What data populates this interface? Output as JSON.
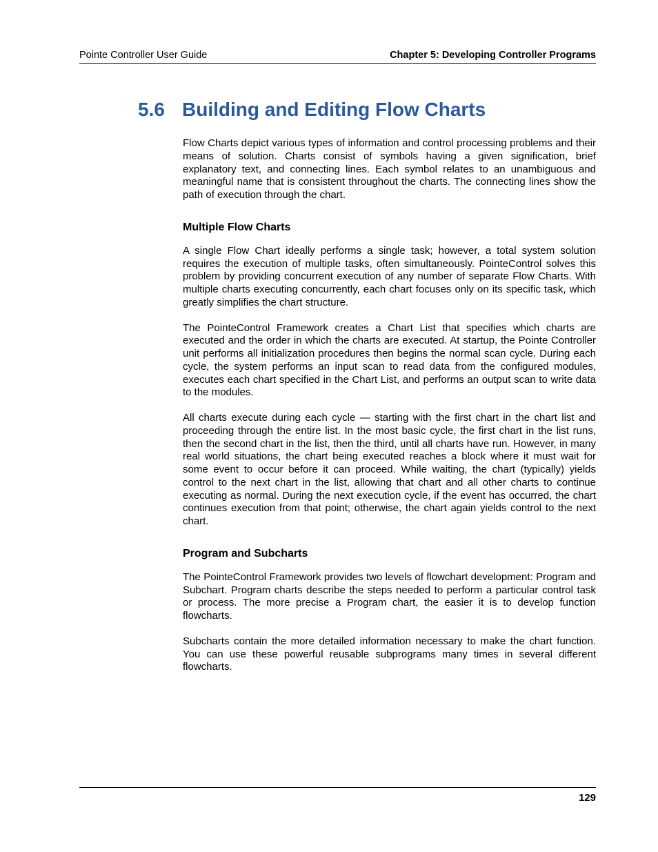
{
  "header": {
    "left": "Pointe Controller User Guide",
    "right": "Chapter 5: Developing Controller Programs"
  },
  "section": {
    "number": "5.6",
    "title": "Building and Editing Flow Charts"
  },
  "intro": "Flow Charts depict various types of information and control processing problems and their means of solution. Charts consist of symbols having a given signification, brief explanatory text, and connecting lines. Each symbol relates to an unambiguous and meaningful name that is consistent throughout the charts. The connecting lines show the path of execution through the chart.",
  "sub1": {
    "heading": "Multiple Flow Charts",
    "p1": "A single Flow Chart ideally performs a single task; however, a total system solution requires the execution of multiple tasks, often simultaneously. PointeControl solves this problem by providing concurrent execution of any number of separate Flow Charts. With multiple charts executing concurrently, each chart focuses only on its specific task, which greatly simplifies the chart structure.",
    "p2": "The PointeControl Framework creates a Chart List that specifies which charts are executed and the order in which the charts are executed. At startup, the Pointe Controller unit performs all initialization procedures then begins the normal scan cycle. During each cycle, the system performs an input scan to read data from the configured modules, executes each chart specified in the Chart List, and performs an output scan to write data to the modules.",
    "p3": "All charts execute during each cycle — starting with the first chart in the chart list and proceeding through the entire list. In the most basic cycle, the first chart in the list runs, then the second chart in the list, then the third, until all charts have run. However, in many real world situations, the chart being executed reaches a block where it must wait for some event to occur before it can proceed. While waiting, the chart (typically) yields control to the next chart in the list, allowing that chart and all other charts to continue executing as normal. During the next execution cycle, if the event has occurred, the chart continues execution from that point; otherwise, the chart again yields control to the next chart."
  },
  "sub2": {
    "heading": "Program and Subcharts",
    "p1": "The PointeControl Framework provides two levels of flowchart development: Program and Subchart. Program charts describe the steps needed to perform a particular control task or process. The more precise a Program chart, the easier it is to develop function flowcharts.",
    "p2": "Subcharts contain the more detailed information necessary to make the chart function. You can use these powerful reusable subprograms many times in several different flowcharts."
  },
  "footer": {
    "page": "129"
  }
}
